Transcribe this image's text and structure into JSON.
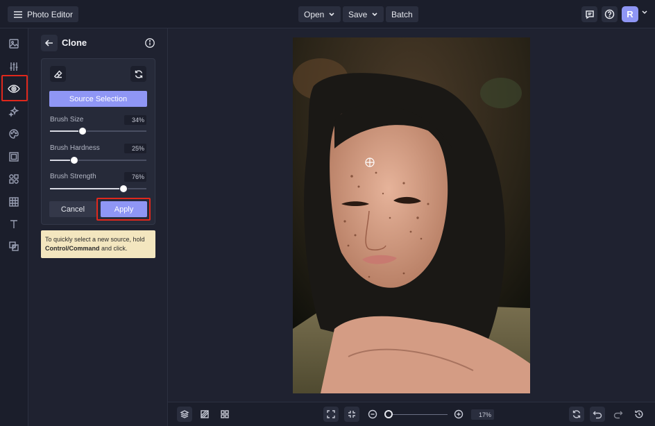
{
  "header": {
    "app_title": "Photo Editor",
    "open_label": "Open",
    "save_label": "Save",
    "batch_label": "Batch",
    "avatar_initial": "R"
  },
  "sidebar": {
    "items": [
      "image-icon",
      "adjust-sliders-icon",
      "eye-icon",
      "sparkle-effects-icon",
      "palette-icon",
      "frame-icon",
      "graphics-icon",
      "texture-icon",
      "text-icon",
      "overlay-icon"
    ],
    "active_item": "eye-icon"
  },
  "panel": {
    "title": "Clone",
    "source_selection_label": "Source Selection",
    "sliders": [
      {
        "label": "Brush Size",
        "value_text": "34%",
        "value": 34
      },
      {
        "label": "Brush Hardness",
        "value_text": "25%",
        "value": 25
      },
      {
        "label": "Brush Strength",
        "value_text": "76%",
        "value": 76
      }
    ],
    "cancel_label": "Cancel",
    "apply_label": "Apply",
    "tip": {
      "line1": "To quickly select a new source, hold",
      "bold": "Control/Command",
      "line2_tail": " and click."
    }
  },
  "footer": {
    "zoom_text": "17%",
    "zoom_value": 17
  },
  "colors": {
    "accent": "#8f96f5",
    "highlight": "#e0281c",
    "tip_bg": "#f3e6bf"
  }
}
